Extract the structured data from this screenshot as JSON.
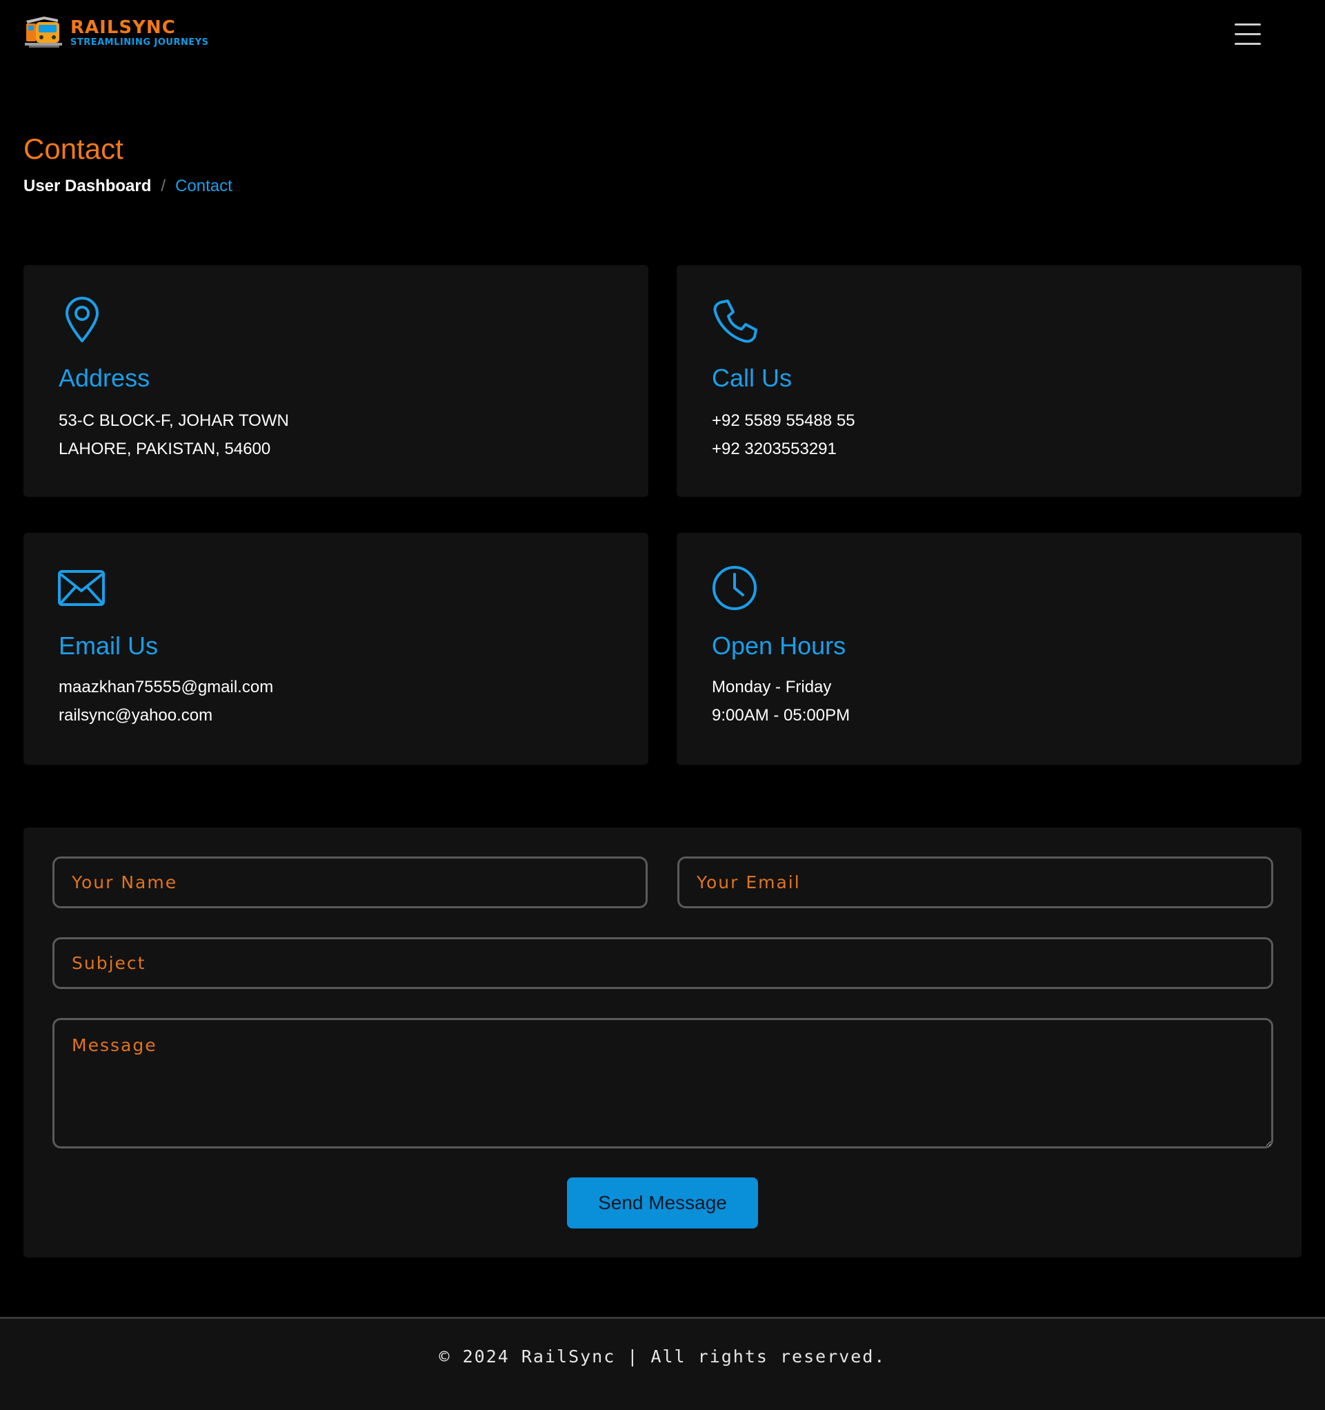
{
  "brand": {
    "name": "RAILSYNC",
    "tagline": "STREAMLINING JOURNEYS"
  },
  "header": {
    "menu_icon": "hamburger-menu-icon"
  },
  "page": {
    "title": "Contact",
    "breadcrumb": {
      "home": "User Dashboard",
      "separator": "/",
      "current": "Contact"
    }
  },
  "cards": {
    "address": {
      "icon": "map-pin-icon",
      "title": "Address",
      "lines": [
        "53-C BLOCK-F, JOHAR TOWN",
        "LAHORE, PAKISTAN, 54600"
      ]
    },
    "call": {
      "icon": "phone-icon",
      "title": "Call Us",
      "lines": [
        "+92 5589 55488 55",
        "+92 3203553291"
      ]
    },
    "email": {
      "icon": "envelope-icon",
      "title": "Email Us",
      "lines": [
        "maazkhan75555@gmail.com",
        "railsync@yahoo.com"
      ]
    },
    "hours": {
      "icon": "clock-icon",
      "title": "Open Hours",
      "lines": [
        "Monday - Friday",
        "9:00AM - 05:00PM"
      ]
    }
  },
  "form": {
    "name_placeholder": "Your Name",
    "email_placeholder": "Your Email",
    "subject_placeholder": "Subject",
    "message_placeholder": "Message",
    "submit_label": "Send Message"
  },
  "footer": {
    "text": "© 2024 RailSync | All rights reserved."
  },
  "colors": {
    "accent_orange": "#f07a16",
    "accent_blue": "#1a9fea",
    "button_blue": "#0a8fd9",
    "card_bg": "#121212",
    "page_bg": "#000000"
  }
}
